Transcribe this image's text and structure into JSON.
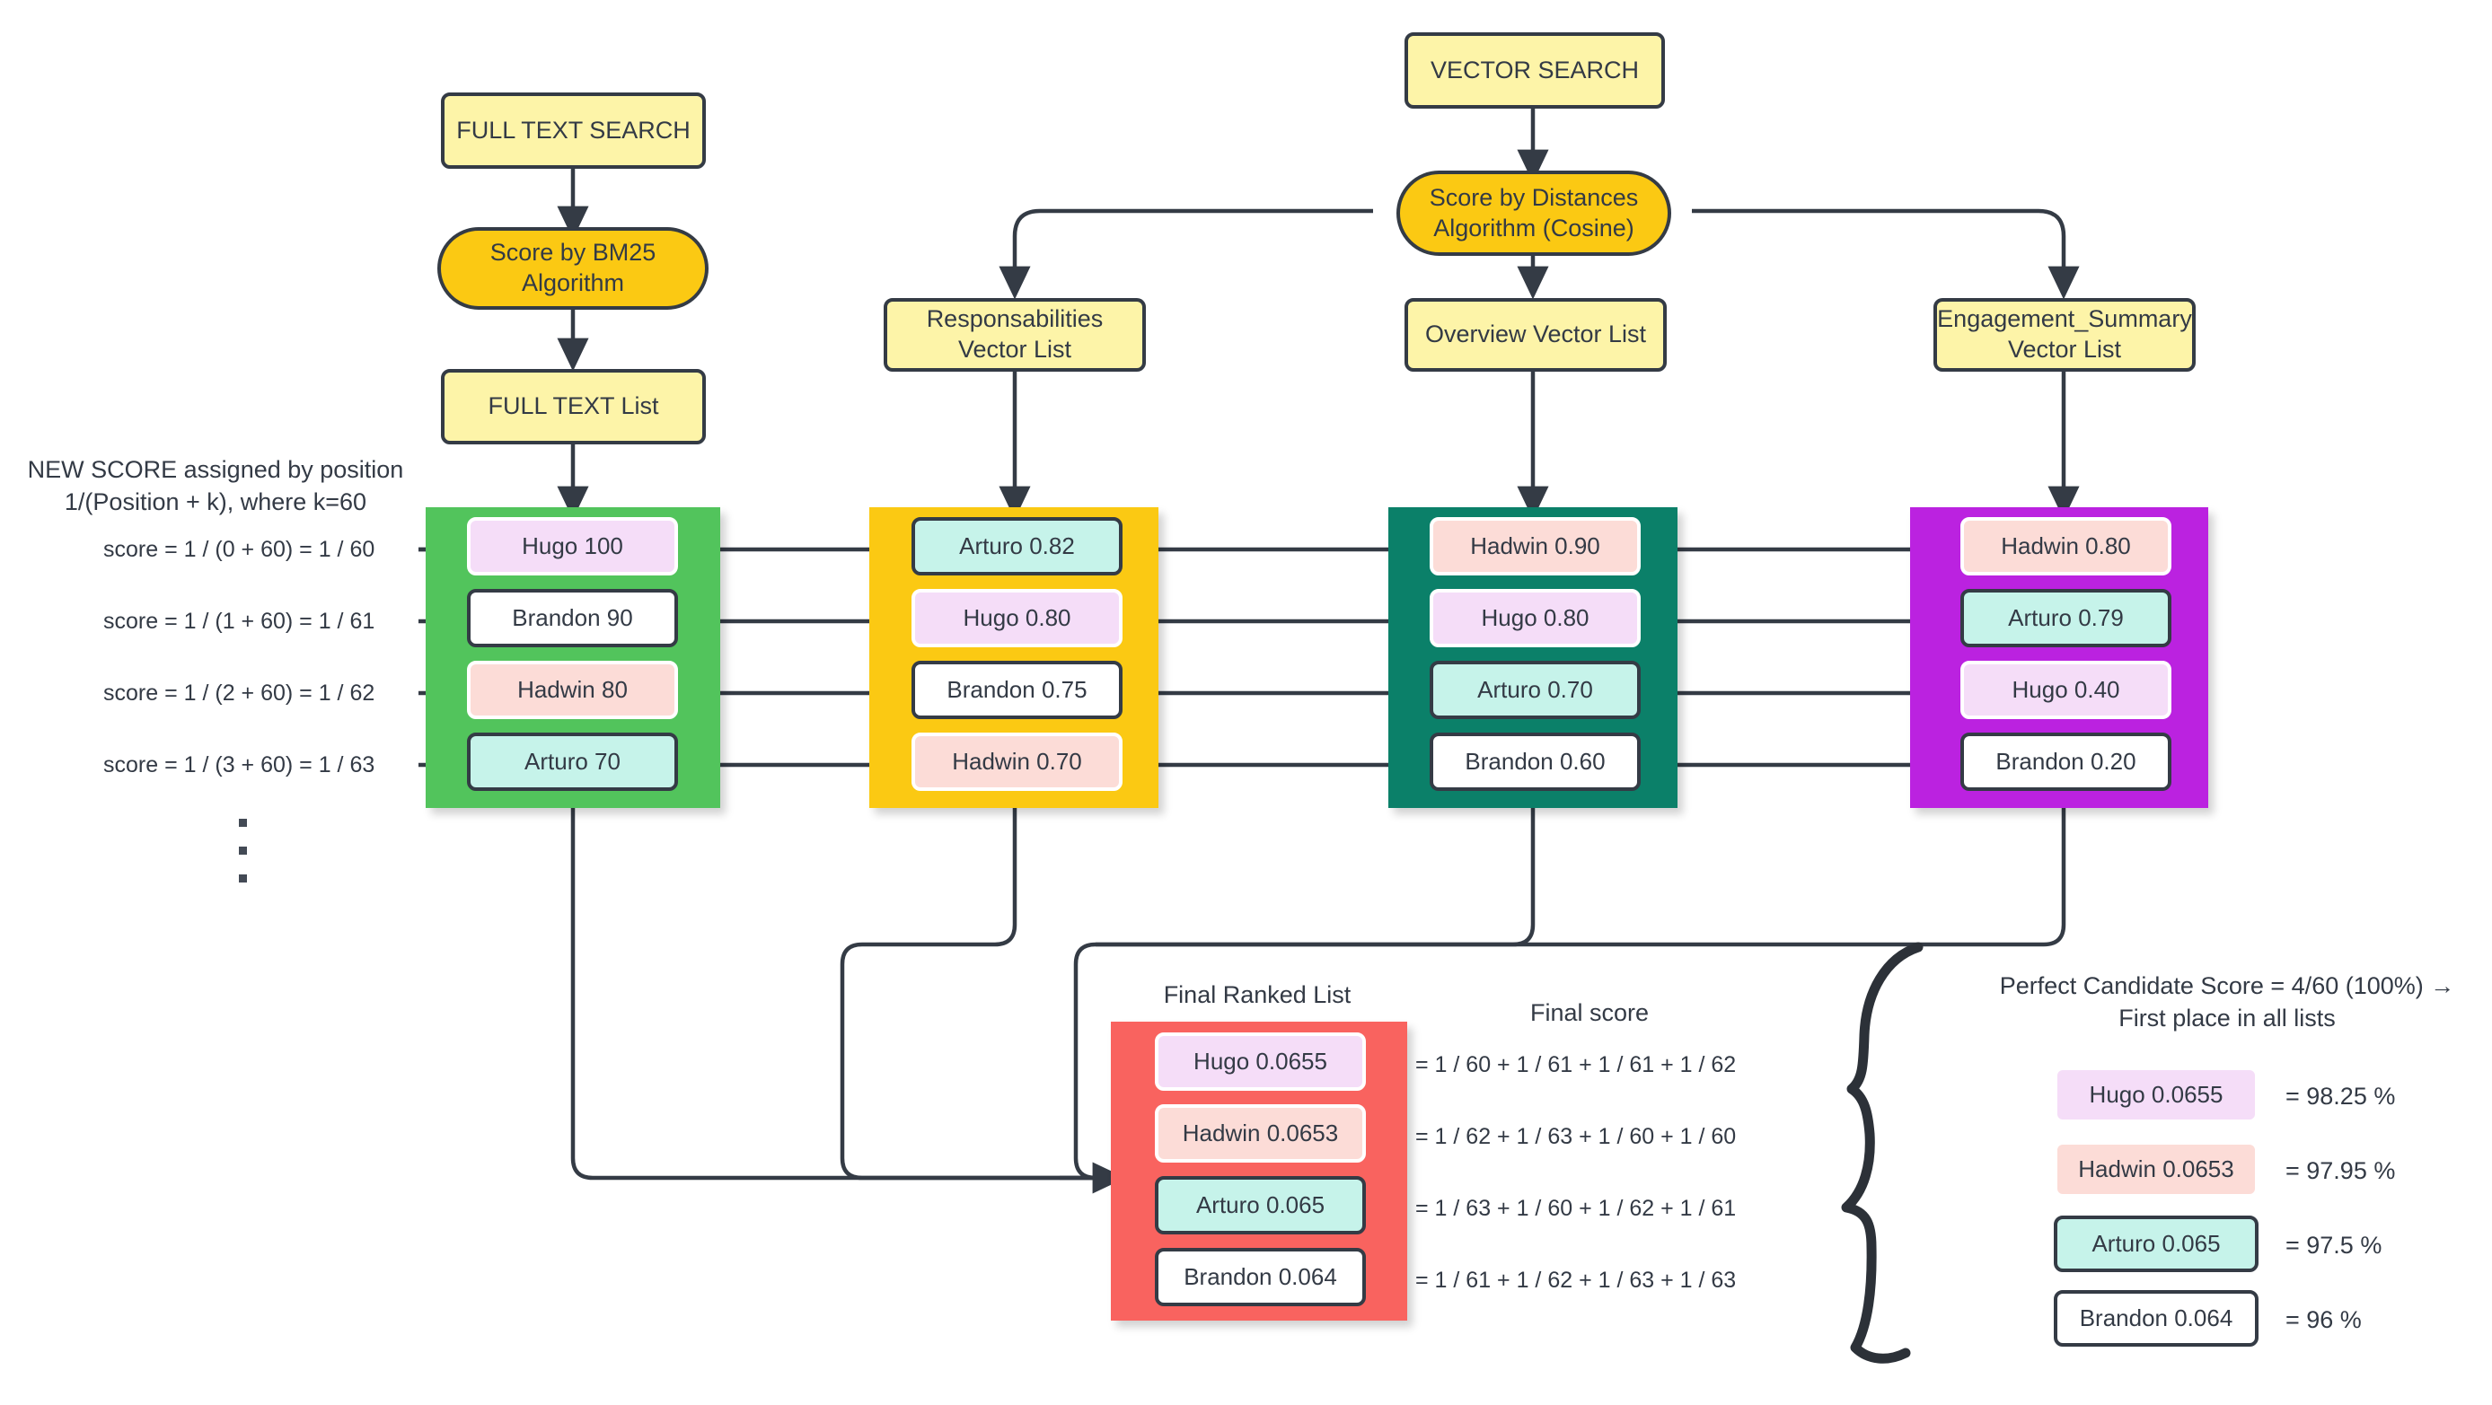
{
  "diagram": {
    "title_note_left": "NEW SCORE assigned by position\n1/(Position + k), where k=60",
    "note_line1": "NEW SCORE assigned by position",
    "note_line2": "1/(Position + k), where k=60"
  },
  "sources": {
    "full_text_search": "FULL TEXT SEARCH",
    "vector_search": "VECTOR SEARCH",
    "bm25": "Score by BM25\nAlgorithm",
    "bm25_line1": "Score by BM25",
    "bm25_line2": "Algorithm",
    "cosine_line1": "Score by Distances",
    "cosine_line2": "Algorithm (Cosine)",
    "full_text_list": "FULL TEXT List"
  },
  "vector_lists": [
    {
      "line1": "Responsabilities",
      "line2": "Vector List"
    },
    {
      "line1": "Overview Vector List",
      "line2": ""
    },
    {
      "line1": "Engagement_Summary",
      "line2": "Vector List"
    }
  ],
  "rrf_scores": [
    "score = 1 / (0 + 60) = 1 / 60",
    "score = 1 / (1 + 60) = 1 / 61",
    "score = 1 / (2 + 60) = 1 / 62",
    "score = 1 / (3 + 60) = 1 / 63"
  ],
  "columns": [
    {
      "name": "full-text-list",
      "band_color": "#52c45c",
      "items": [
        {
          "label": "Hugo 100",
          "fill": "#f5ddf8",
          "style": "soft"
        },
        {
          "label": "Brandon 90",
          "fill": "#ffffff",
          "style": "bordered"
        },
        {
          "label": "Hadwin 80",
          "fill": "#fcdcd7",
          "style": "soft"
        },
        {
          "label": "Arturo 70",
          "fill": "#c6f3ea",
          "style": "bordered"
        }
      ]
    },
    {
      "name": "responsabilities-vector-list",
      "band_color": "#fbc913",
      "items": [
        {
          "label": "Arturo 0.82",
          "fill": "#c6f3ea",
          "style": "bordered"
        },
        {
          "label": "Hugo 0.80",
          "fill": "#f5ddf8",
          "style": "soft"
        },
        {
          "label": "Brandon 0.75",
          "fill": "#ffffff",
          "style": "bordered"
        },
        {
          "label": "Hadwin 0.70",
          "fill": "#fcdcd7",
          "style": "soft"
        }
      ]
    },
    {
      "name": "overview-vector-list",
      "band_color": "#0b8069",
      "items": [
        {
          "label": "Hadwin 0.90",
          "fill": "#fcdcd7",
          "style": "soft"
        },
        {
          "label": "Hugo 0.80",
          "fill": "#f5ddf8",
          "style": "soft"
        },
        {
          "label": "Arturo 0.70",
          "fill": "#c6f3ea",
          "style": "bordered"
        },
        {
          "label": "Brandon 0.60",
          "fill": "#ffffff",
          "style": "bordered"
        }
      ]
    },
    {
      "name": "engagement-summary-vector-list",
      "band_color": "#bb22e0",
      "items": [
        {
          "label": "Hadwin 0.80",
          "fill": "#fcdcd7",
          "style": "soft"
        },
        {
          "label": "Arturo 0.79",
          "fill": "#c6f3ea",
          "style": "bordered"
        },
        {
          "label": "Hugo 0.40",
          "fill": "#f5ddf8",
          "style": "soft"
        },
        {
          "label": "Brandon 0.20",
          "fill": "#ffffff",
          "style": "bordered"
        }
      ]
    }
  ],
  "final": {
    "title": "Final Ranked List",
    "band_color": "#f9635f",
    "items": [
      {
        "label": "Hugo 0.0655",
        "fill": "#f5ddf8",
        "style": "soft"
      },
      {
        "label": "Hadwin 0.0653",
        "fill": "#fcdcd7",
        "style": "soft"
      },
      {
        "label": "Arturo 0.065",
        "fill": "#c6f3ea",
        "style": "bordered"
      },
      {
        "label": "Brandon 0.064",
        "fill": "#ffffff",
        "style": "bordered"
      }
    ]
  },
  "final_score": {
    "title": "Final score",
    "formulas": [
      "= 1 / 60 + 1 / 61 + 1 / 61 + 1 / 62",
      "= 1 / 62 + 1 / 63 + 1 / 60 + 1 / 60",
      "= 1 / 63 + 1 / 60 + 1 / 62 + 1 / 61",
      "= 1 / 61 + 1 / 62 + 1 / 63 + 1 / 63"
    ]
  },
  "perfect": {
    "line1": "Perfect Candidate Score = 4/60 (100%) →",
    "line2": "First place in all lists",
    "items": [
      {
        "label": "Hugo 0.0655",
        "pct": "= 98.25 %",
        "fill": "#f5ddf8",
        "style": "soft"
      },
      {
        "label": "Hadwin 0.0653",
        "pct": "= 97.95 %",
        "fill": "#fcdcd7",
        "style": "soft"
      },
      {
        "label": "Arturo 0.065",
        "pct": "= 97.5 %",
        "fill": "#c6f3ea",
        "style": "bordered"
      },
      {
        "label": "Brandon 0.064",
        "pct": "= 96 %",
        "fill": "#ffffff",
        "style": "bordered"
      }
    ]
  },
  "chart_data": {
    "type": "table",
    "title": "Reciprocal Rank Fusion across 4 retrieval lists",
    "k": 60,
    "candidates": [
      "Hugo",
      "Hadwin",
      "Arturo",
      "Brandon"
    ],
    "lists": [
      "FULL TEXT List",
      "Responsabilities Vector List",
      "Overview Vector List",
      "Engagement_Summary Vector List"
    ],
    "raw_scores": {
      "FULL TEXT List": {
        "Hugo": 100,
        "Brandon": 90,
        "Hadwin": 80,
        "Arturo": 70
      },
      "Responsabilities Vector List": {
        "Arturo": 0.82,
        "Hugo": 0.8,
        "Brandon": 0.75,
        "Hadwin": 0.7
      },
      "Overview Vector List": {
        "Hadwin": 0.9,
        "Hugo": 0.8,
        "Arturo": 0.7,
        "Brandon": 0.6
      },
      "Engagement_Summary Vector List": {
        "Hadwin": 0.8,
        "Arturo": 0.79,
        "Hugo": 0.4,
        "Brandon": 0.2
      }
    },
    "ranks": {
      "FULL TEXT List": [
        "Hugo",
        "Brandon",
        "Hadwin",
        "Arturo"
      ],
      "Responsabilities Vector List": [
        "Arturo",
        "Hugo",
        "Brandon",
        "Hadwin"
      ],
      "Overview Vector List": [
        "Hadwin",
        "Hugo",
        "Arturo",
        "Brandon"
      ],
      "Engagement_Summary Vector List": [
        "Hadwin",
        "Arturo",
        "Hugo",
        "Brandon"
      ]
    },
    "final_scores": {
      "Hugo": 0.0655,
      "Hadwin": 0.0653,
      "Arturo": 0.065,
      "Brandon": 0.064
    },
    "final_percent": {
      "Hugo": 98.25,
      "Hadwin": 97.95,
      "Arturo": 97.5,
      "Brandon": 96
    },
    "perfect_score": "4/60"
  }
}
